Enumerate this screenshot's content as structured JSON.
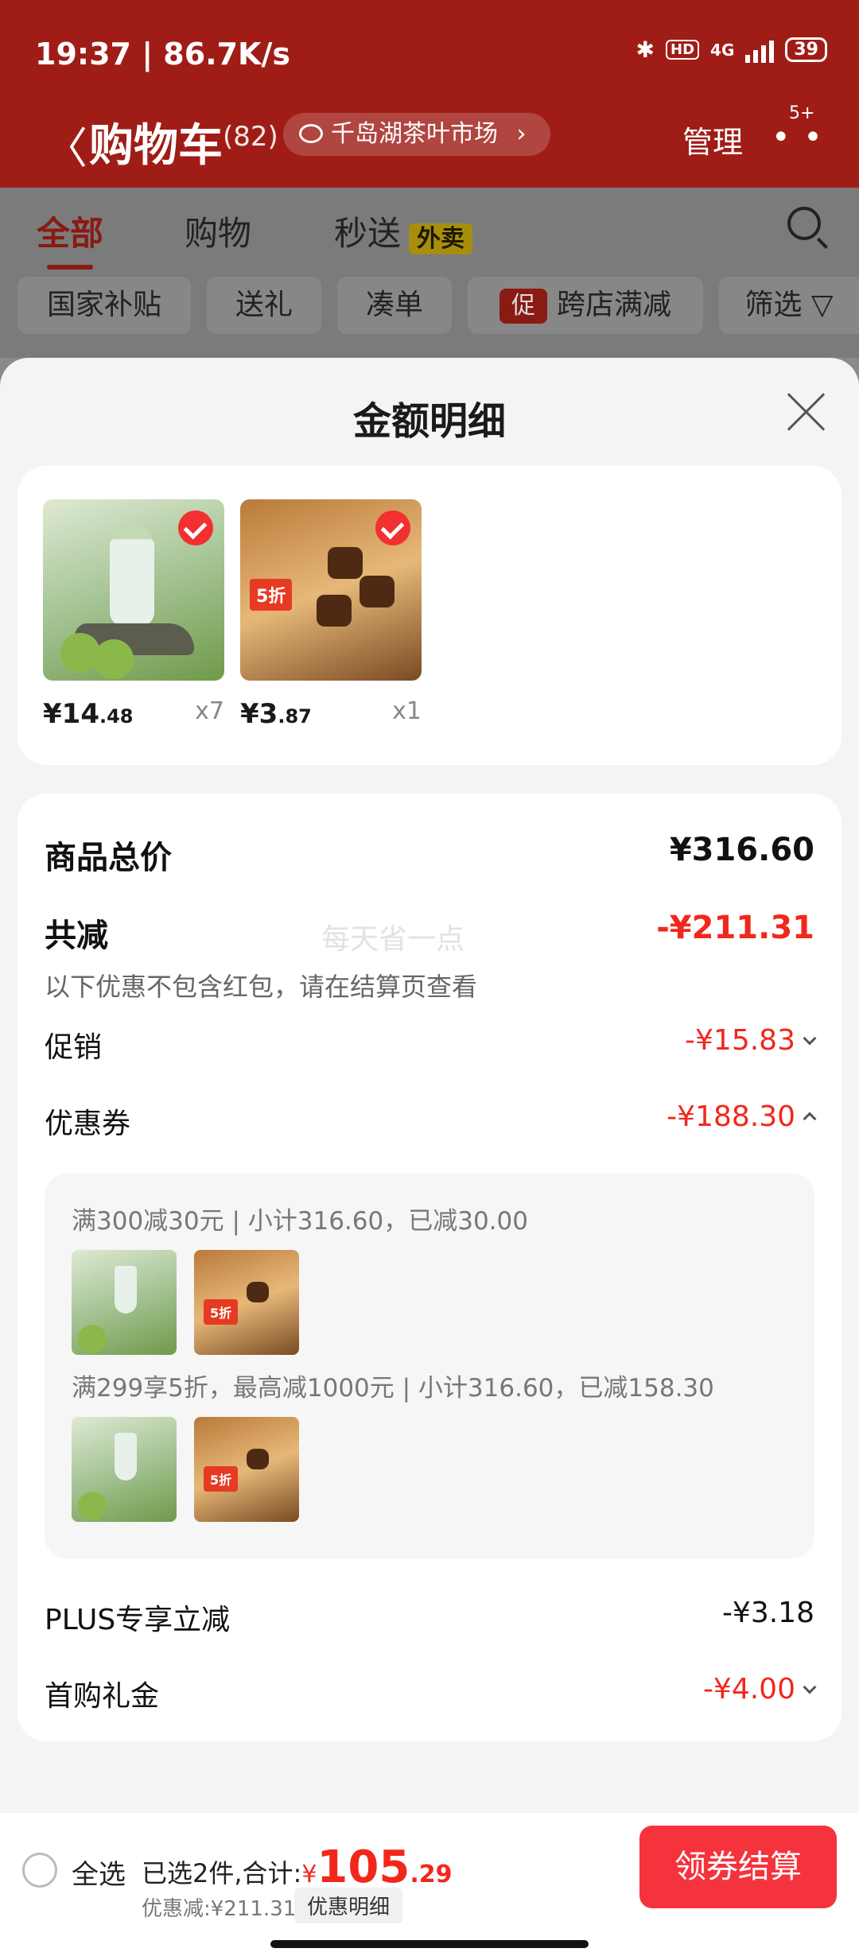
{
  "status_bar": {
    "time": "19:37 | 86.7K/s",
    "hd": "HD",
    "network": "4G",
    "battery": "39"
  },
  "header": {
    "back_glyph": "〈",
    "title": "购物车",
    "count": "(82)",
    "location": "千岛湖茶叶市场",
    "location_chevron": "›",
    "manage": "管理",
    "more_badge": "5+"
  },
  "tabs": [
    {
      "label": "全部",
      "active": true
    },
    {
      "label": "购物",
      "active": false
    },
    {
      "label": "秒送",
      "badge": "外卖",
      "active": false
    }
  ],
  "chips": [
    "国家补贴",
    "送礼",
    "凑单",
    "跨店满减",
    "筛选"
  ],
  "chip_promo_icon": "促",
  "sheet": {
    "title": "金额明细",
    "products": [
      {
        "price_main": "¥14",
        "price_cents": ".48",
        "qty": "x7",
        "checked": true
      },
      {
        "price_main": "¥3",
        "price_cents": ".87",
        "qty": "x1",
        "checked": true
      }
    ],
    "product_total_label": "商品总价",
    "product_total_value": "¥316.60",
    "reduction_label": "共减",
    "reduction_value": "-¥211.31",
    "watermark": "每天省一点",
    "note": "以下优惠不包含红包，请在结算页查看",
    "promo_label": "促销",
    "promo_value": "-¥15.83",
    "coupon_label": "优惠券",
    "coupon_value": "-¥188.30",
    "coupons": [
      {
        "text": "满300减30元 | 小计316.60，已减30.00"
      },
      {
        "text": "满299享5折，最高减1000元 | 小计316.60，已减158.30"
      }
    ],
    "plus_label": "PLUS专享立减",
    "plus_value": "-¥3.18",
    "first_label": "首购礼金",
    "first_value": "-¥4.00"
  },
  "bottom": {
    "select_all": "全选",
    "selected_text": "已选2件,合计:",
    "total_yen": "¥",
    "total_main": "105",
    "total_cents": ".29",
    "discount_text": "优惠减:¥211.31",
    "detail_button": "优惠明细",
    "checkout_button": "领券结算"
  },
  "colors": {
    "brand_red": "#f2271c",
    "header_red": "#a01d17",
    "checkout_red": "#f5333d"
  }
}
